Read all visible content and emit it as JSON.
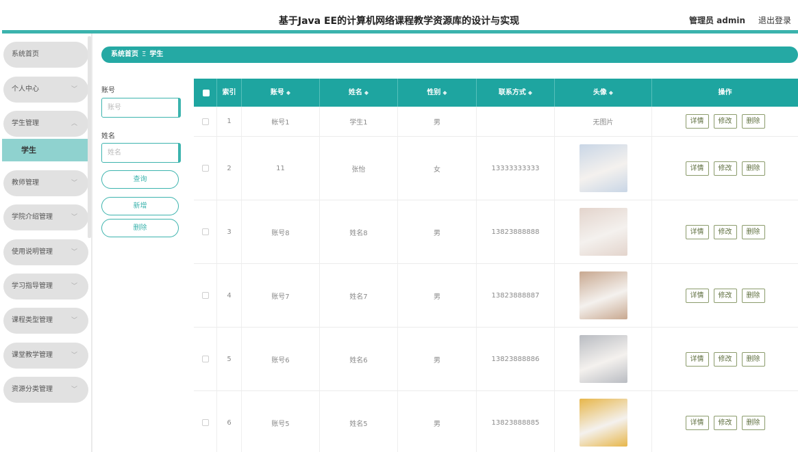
{
  "header": {
    "title": "基于Java EE的计算机网络课程教学资源库的设计与实现",
    "user": "管理员 admin",
    "logout": "退出登录"
  },
  "sidebar": {
    "items": [
      {
        "label": "系统首页",
        "chevron": ""
      },
      {
        "label": "个人中心",
        "chevron": "chevron-down-icon"
      },
      {
        "label": "学生管理",
        "chevron": "chevron-up-icon"
      },
      {
        "label": "教师管理",
        "chevron": "chevron-down-icon"
      },
      {
        "label": "学院介绍管理",
        "chevron": "chevron-down-icon"
      },
      {
        "label": "使用说明管理",
        "chevron": "chevron-down-icon"
      },
      {
        "label": "学习指导管理",
        "chevron": "chevron-down-icon"
      },
      {
        "label": "课程类型管理",
        "chevron": "chevron-down-icon"
      },
      {
        "label": "课堂教学管理",
        "chevron": "chevron-down-icon"
      },
      {
        "label": "资源分类管理",
        "chevron": "chevron-down-icon"
      }
    ],
    "active_sub": "学生"
  },
  "breadcrumb": {
    "home": "系统首页",
    "separator": "Ξ",
    "current": "学生"
  },
  "search": {
    "account_label": "账号",
    "account_placeholder": "账号",
    "name_label": "姓名",
    "name_placeholder": "姓名",
    "query_button": "查询",
    "add_button": "新增",
    "delete_button": "删除"
  },
  "table": {
    "columns": [
      "索引",
      "账号",
      "姓名",
      "性别",
      "联系方式",
      "头像",
      "操作"
    ],
    "sort_icon": "sort-icon",
    "ops": [
      "详情",
      "修改",
      "删除"
    ],
    "rows": [
      {
        "index": "1",
        "account": "帐号1",
        "name": "学生1",
        "gender": "男",
        "phone": "",
        "avatar": "无图片",
        "avatar_color": ""
      },
      {
        "index": "2",
        "account": "11",
        "name": "张怡",
        "gender": "女",
        "phone": "13333333333",
        "avatar": "",
        "avatar_color": "#c9d6e6"
      },
      {
        "index": "3",
        "account": "账号8",
        "name": "姓名8",
        "gender": "男",
        "phone": "13823888888",
        "avatar": "",
        "avatar_color": "#e3d4cc"
      },
      {
        "index": "4",
        "account": "账号7",
        "name": "姓名7",
        "gender": "男",
        "phone": "13823888887",
        "avatar": "",
        "avatar_color": "#c8a890"
      },
      {
        "index": "5",
        "account": "账号6",
        "name": "姓名6",
        "gender": "男",
        "phone": "13823888886",
        "avatar": "",
        "avatar_color": "#b9bcc2"
      },
      {
        "index": "6",
        "account": "账号5",
        "name": "姓名5",
        "gender": "男",
        "phone": "13823888885",
        "avatar": "",
        "avatar_color": "#e7b64a"
      }
    ]
  },
  "colors": {
    "accent": "#3bb3ad",
    "table_header": "#1ea5a0",
    "breadcrumb": "#25a9a4",
    "active_sub": "#8fd2cf"
  }
}
